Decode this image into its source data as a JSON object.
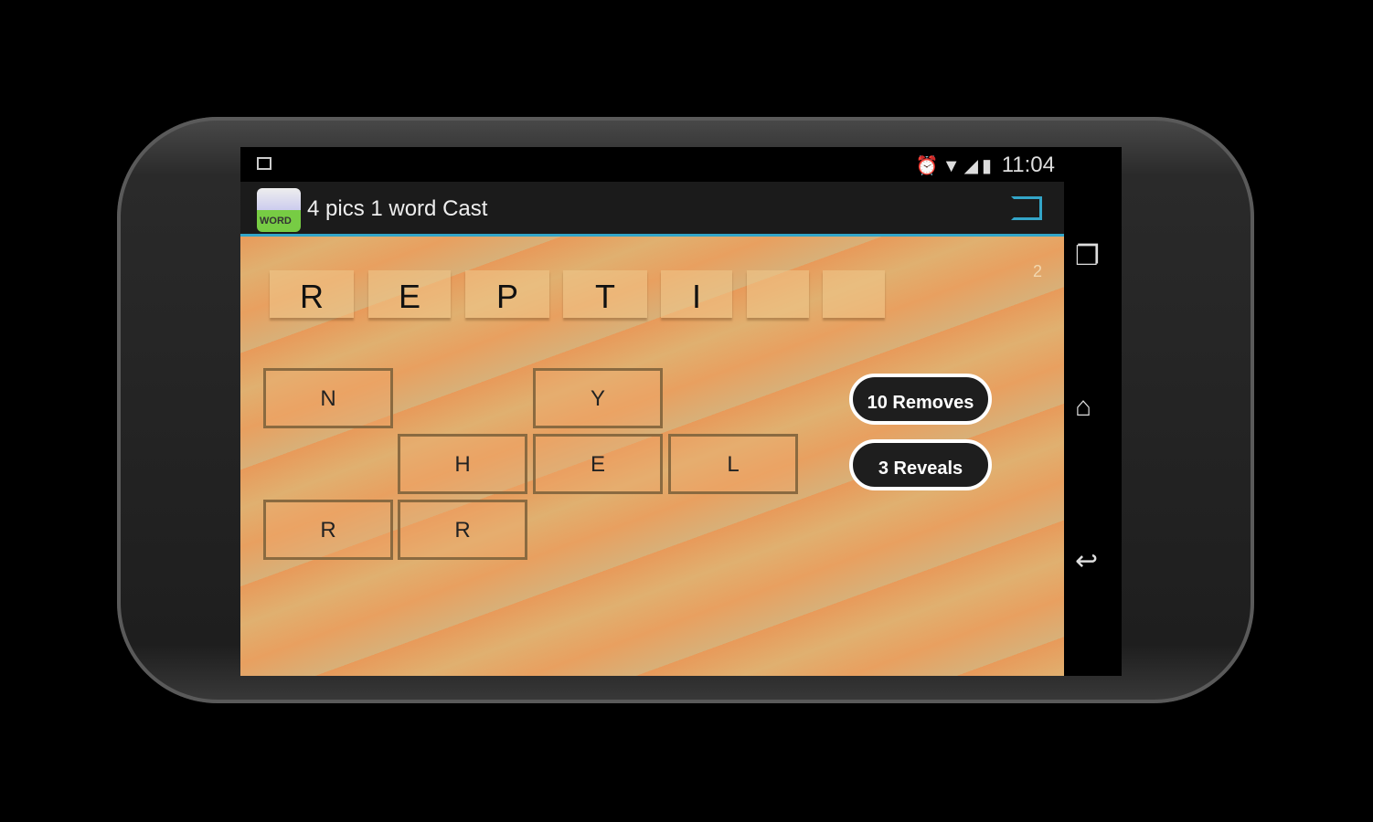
{
  "status": {
    "time": "11:04",
    "icons": [
      "gallery-icon",
      "alarm-icon",
      "wifi-icon",
      "signal-icon",
      "battery-icon"
    ]
  },
  "app": {
    "title": "4 pics 1 word Cast",
    "icon_text": "WORD"
  },
  "game": {
    "level": "2",
    "answer": [
      "R",
      "E",
      "P",
      "T",
      "I",
      "",
      ""
    ],
    "tiles": [
      "N",
      "Y",
      "H",
      "E",
      "L",
      "R",
      "R"
    ],
    "removes_label": "10 Removes",
    "reveals_label": "3 Reveals"
  },
  "colors": {
    "accent": "#33a5c8"
  }
}
